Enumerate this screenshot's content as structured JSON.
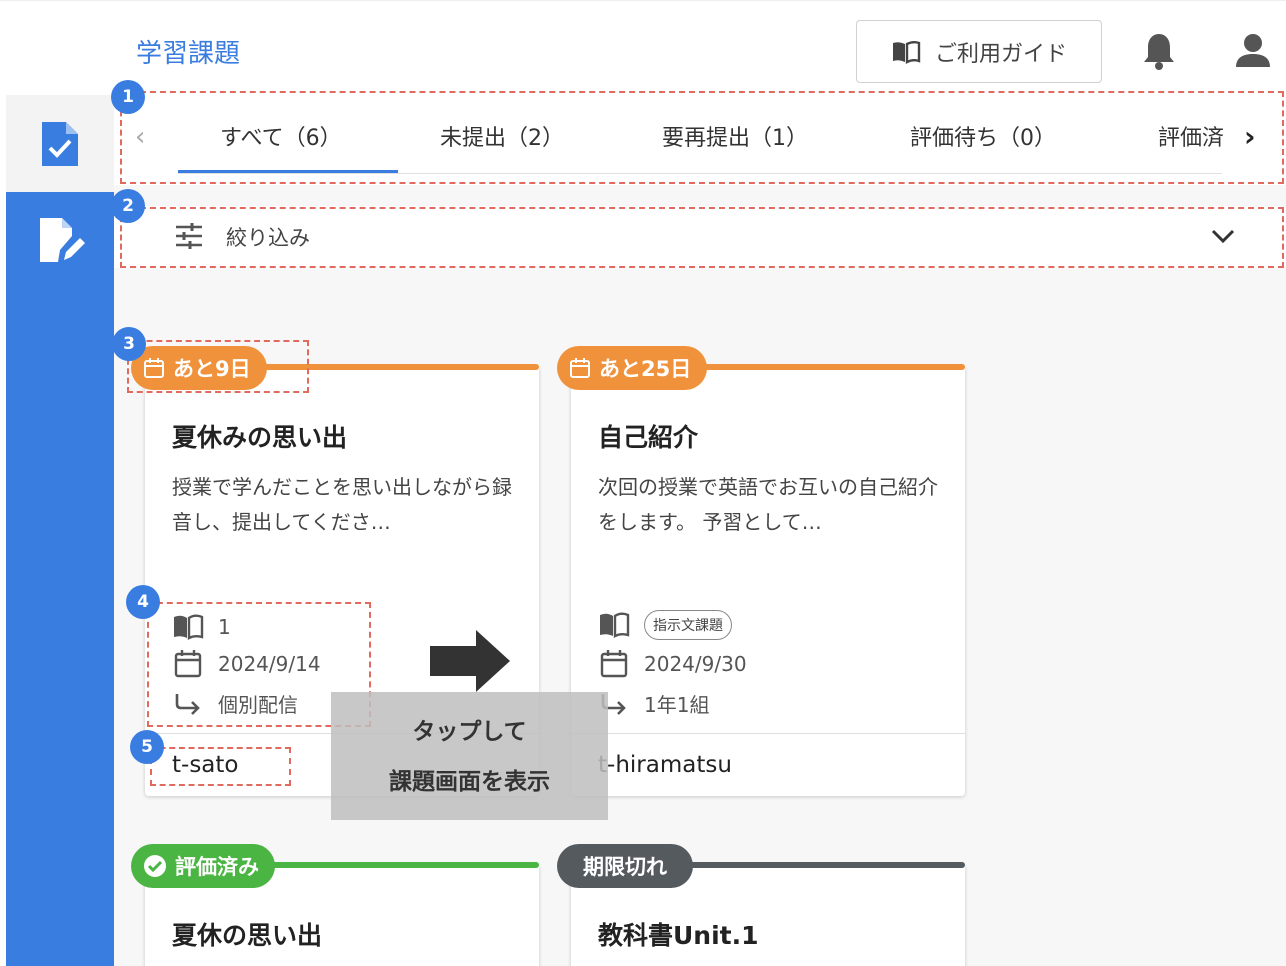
{
  "header": {
    "title": "学習課題",
    "guide_label": "ご利用ガイド",
    "icons": [
      "book-icon",
      "bell-icon",
      "user-icon"
    ]
  },
  "sidebar": {
    "items": [
      {
        "name": "assignment-check-icon"
      },
      {
        "name": "edit-document-icon"
      }
    ],
    "accent": "#3a7de0"
  },
  "tabs": {
    "items": [
      {
        "label": "すべて（6）"
      },
      {
        "label": "未提出（2）"
      },
      {
        "label": "要再提出（1）"
      },
      {
        "label": "評価待ち（0）"
      },
      {
        "label": "評価済"
      }
    ],
    "active_index": 0
  },
  "filter": {
    "label": "絞り込み"
  },
  "cards": [
    {
      "badge": "あと9日",
      "badge_color": "#f0923c",
      "title": "夏休みの思い出",
      "desc": "授業で学んだことを思い出しながら録音し、提出してくださ…",
      "textbook": "1",
      "date": "2024/9/14",
      "delivery": "個別配信",
      "user": "t-sato"
    },
    {
      "badge": "あと25日",
      "badge_color": "#f0923c",
      "title": "自己紹介",
      "desc": "次回の授業で英語でお互いの自己紹介をします。 予習として…",
      "tag": "指示文課題",
      "date": "2024/9/30",
      "delivery": "1年1組",
      "user": "t-hiramatsu"
    },
    {
      "badge": "評価済み",
      "badge_color": "#4bb543",
      "title": "夏休の思い出"
    },
    {
      "badge": "期限切れ",
      "badge_color": "#555a5f",
      "title": "教科書Unit.1"
    }
  ],
  "annotations": {
    "numbers": [
      "1",
      "2",
      "3",
      "4",
      "5"
    ],
    "tooltip_line1": "タップして",
    "tooltip_line2": "課題画面を表示"
  }
}
